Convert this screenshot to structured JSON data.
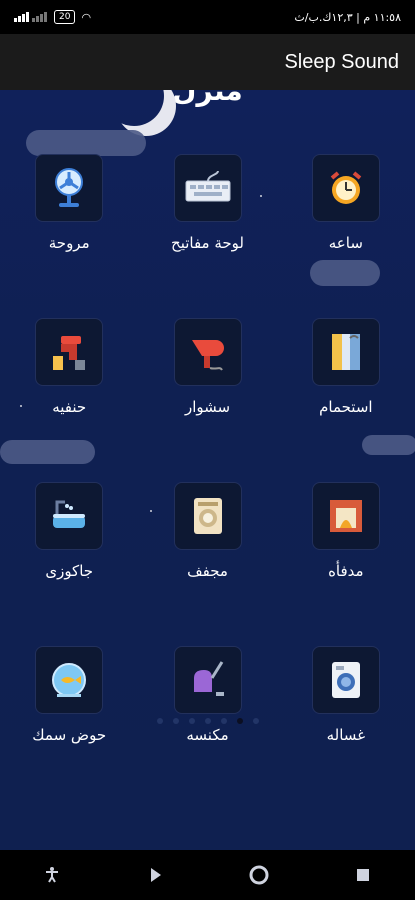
{
  "status": {
    "battery": "20",
    "time": "١١:٥٨ م | ١٢,٣ك.ب/ث"
  },
  "app": {
    "title": "Sleep Sound"
  },
  "background_title": "منزل",
  "tiles": [
    {
      "label": "ساعه",
      "icon": "alarm-clock-icon"
    },
    {
      "label": "لوحة مفاتيح",
      "icon": "keyboard-icon"
    },
    {
      "label": "مروحة",
      "icon": "fan-icon"
    },
    {
      "label": "استحمام",
      "icon": "shower-icon"
    },
    {
      "label": "سشوار",
      "icon": "hair-dryer-icon"
    },
    {
      "label": "حنفيه",
      "icon": "faucet-icon"
    },
    {
      "label": "مدفأه",
      "icon": "fireplace-icon"
    },
    {
      "label": "مجفف",
      "icon": "dryer-icon"
    },
    {
      "label": "جاكوزى",
      "icon": "jacuzzi-icon"
    },
    {
      "label": "غساله",
      "icon": "washing-machine-icon"
    },
    {
      "label": "مكنسه",
      "icon": "vacuum-icon"
    },
    {
      "label": "حوض سمك",
      "icon": "fish-bowl-icon"
    }
  ],
  "pager": {
    "count": 7,
    "active_index": 5
  },
  "nav": [
    "accessibility-icon",
    "back-icon",
    "home-icon",
    "recents-icon"
  ],
  "colors": {
    "background": "#0f2052",
    "appbar": "#1b1b1b"
  }
}
